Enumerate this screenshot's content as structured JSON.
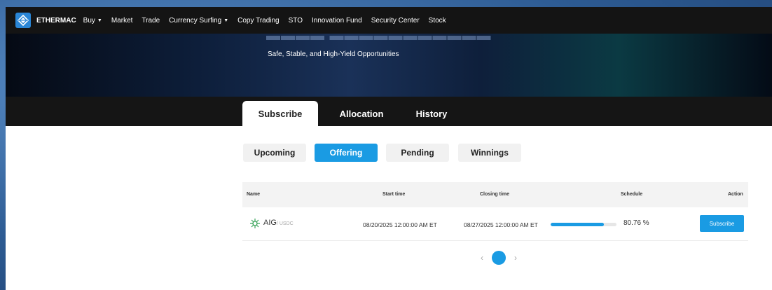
{
  "nav": {
    "brand": "ETHERMAC",
    "items": [
      {
        "label": "Buy",
        "dropdown": true
      },
      {
        "label": "Market",
        "dropdown": false
      },
      {
        "label": "Trade",
        "dropdown": false
      },
      {
        "label": "Currency Surfing",
        "dropdown": true
      },
      {
        "label": "Copy Trading",
        "dropdown": false
      },
      {
        "label": "STO",
        "dropdown": false
      },
      {
        "label": "Innovation Fund",
        "dropdown": false
      },
      {
        "label": "Security Center",
        "dropdown": false
      },
      {
        "label": "Stock",
        "dropdown": false
      }
    ]
  },
  "hero": {
    "subtitle": "Safe, Stable, and High-Yield Opportunities"
  },
  "main_tabs": [
    {
      "label": "Subscribe",
      "active": true
    },
    {
      "label": "Allocation",
      "active": false
    },
    {
      "label": "History",
      "active": false
    }
  ],
  "sub_tabs": [
    {
      "label": "Upcoming",
      "active": false
    },
    {
      "label": "Offering",
      "active": true
    },
    {
      "label": "Pending",
      "active": false
    },
    {
      "label": "Winnings",
      "active": false
    }
  ],
  "table": {
    "columns": [
      "Name",
      "Start time",
      "Closing time",
      "Schedule",
      "Action"
    ],
    "rows": [
      {
        "name": "AIG",
        "pair": "/ USDC",
        "start_time": "08/20/2025 12:00:00 AM ET",
        "closing_time": "08/27/2025 12:00:00 AM ET",
        "progress": 80.76,
        "progress_label": "80.76 %",
        "action": "Subscribe"
      }
    ]
  },
  "pagination": {
    "current": "1",
    "prev": "‹",
    "next": "›"
  },
  "colors": {
    "accent": "#1a9be3",
    "nav_bg": "#141414"
  }
}
